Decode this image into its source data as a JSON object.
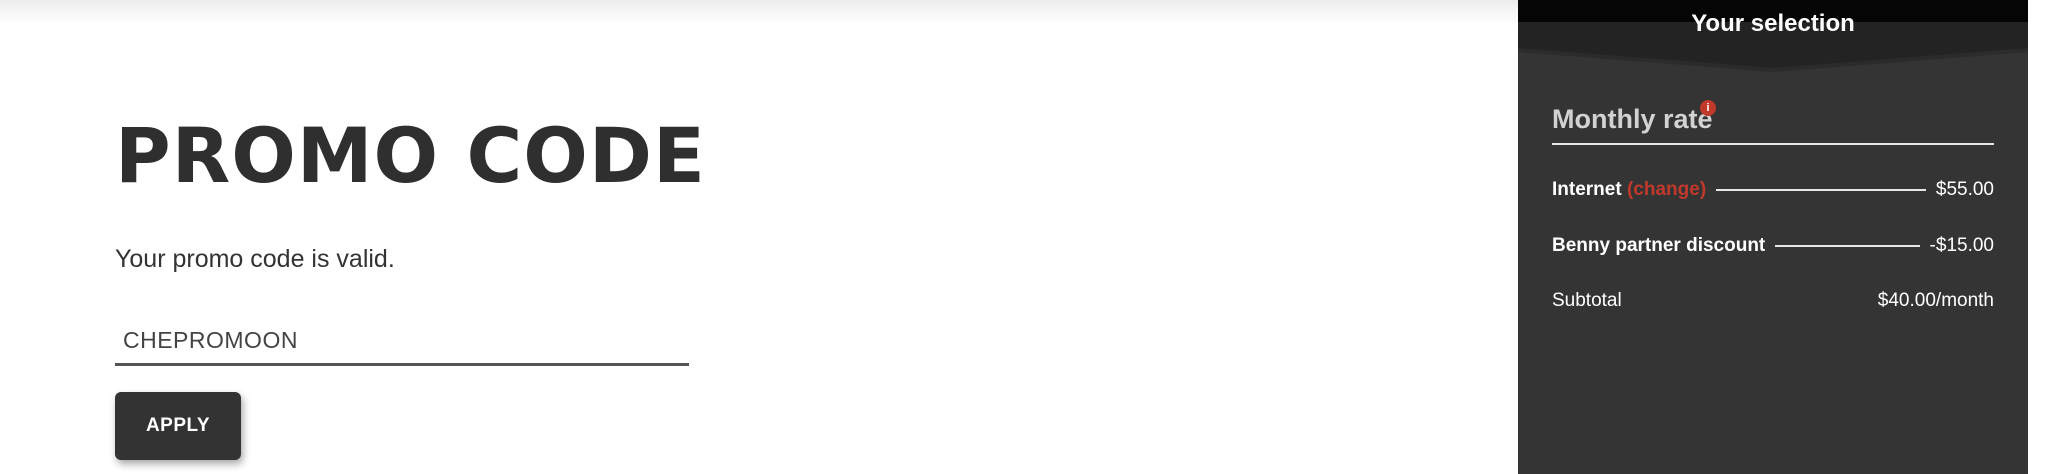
{
  "promo": {
    "title": "PROMO CODE",
    "message": "Your promo code is valid.",
    "code_value": "CHEPROMOON",
    "apply_label": "APPLY"
  },
  "selection": {
    "title": "Your selection",
    "rate_title": "Monthly rate",
    "info_icon": "i",
    "lines": [
      {
        "label": "Internet",
        "link": "(change)",
        "value": "$55.00"
      },
      {
        "label": "Benny partner discount",
        "value": "-$15.00"
      },
      {
        "label": "Subtotal",
        "value": "$40.00/month"
      }
    ]
  },
  "colors": {
    "panel_background": "#343434",
    "header_background": "#050505",
    "accent_red": "#c0392b",
    "button_background": "#333333"
  }
}
